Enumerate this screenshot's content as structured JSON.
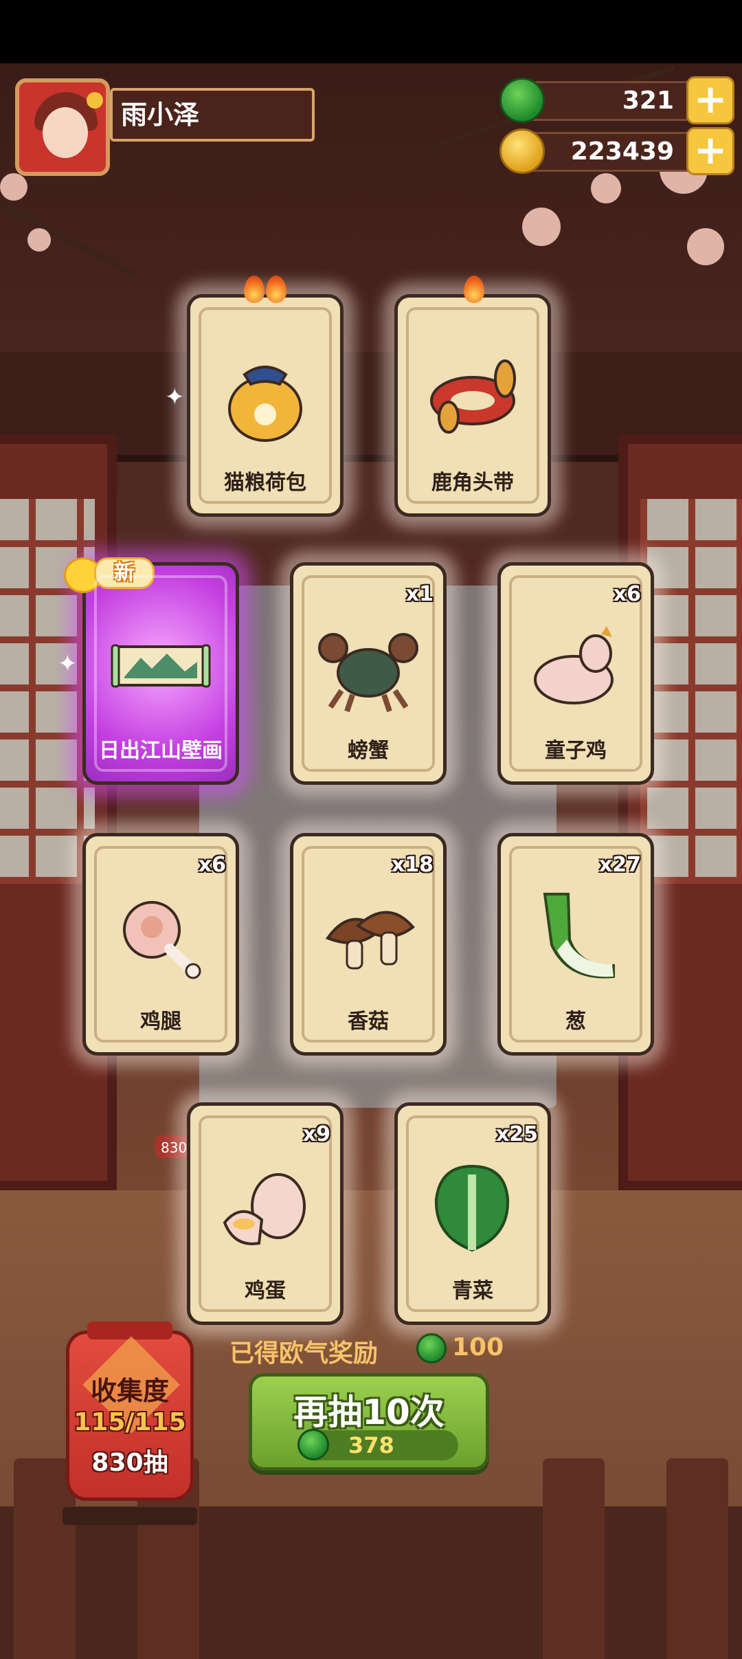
{
  "player": {
    "name": "雨小泽"
  },
  "currencies": {
    "jade": "321",
    "gold": "223439"
  },
  "cards": [
    {
      "label": "猫粮荷包",
      "qty": "",
      "flames": 2,
      "art": "pouch-icon"
    },
    {
      "label": "鹿角头带",
      "qty": "",
      "flames": 1,
      "art": "headband-icon"
    },
    {
      "label": "日出江山壁画",
      "qty": "",
      "new": "新",
      "art": "mural-painting-icon"
    },
    {
      "label": "螃蟹",
      "qty": "x1",
      "art": "crab-icon"
    },
    {
      "label": "童子鸡",
      "qty": "x6",
      "art": "chicken-icon"
    },
    {
      "label": "鸡腿",
      "qty": "x6",
      "art": "drumstick-icon"
    },
    {
      "label": "香菇",
      "qty": "x18",
      "art": "mushroom-icon"
    },
    {
      "label": "葱",
      "qty": "x27",
      "art": "scallion-icon"
    },
    {
      "label": "鸡蛋",
      "qty": "x9",
      "art": "egg-icon"
    },
    {
      "label": "青菜",
      "qty": "x25",
      "art": "greens-icon"
    }
  ],
  "reward": {
    "label": "已得欧气奖励",
    "value": "100"
  },
  "draw_button": {
    "label": "再抽10次",
    "cost": "378"
  },
  "collection": {
    "title": "收集度",
    "progress": "115/115",
    "draws": "830抽"
  },
  "background_tag": "830抽",
  "colors": {
    "jade": "#1f8a2b",
    "gold": "#e0a21b",
    "card": "#f1dfb5",
    "new_card": "#c33ee0",
    "button": "#7fb63a"
  }
}
